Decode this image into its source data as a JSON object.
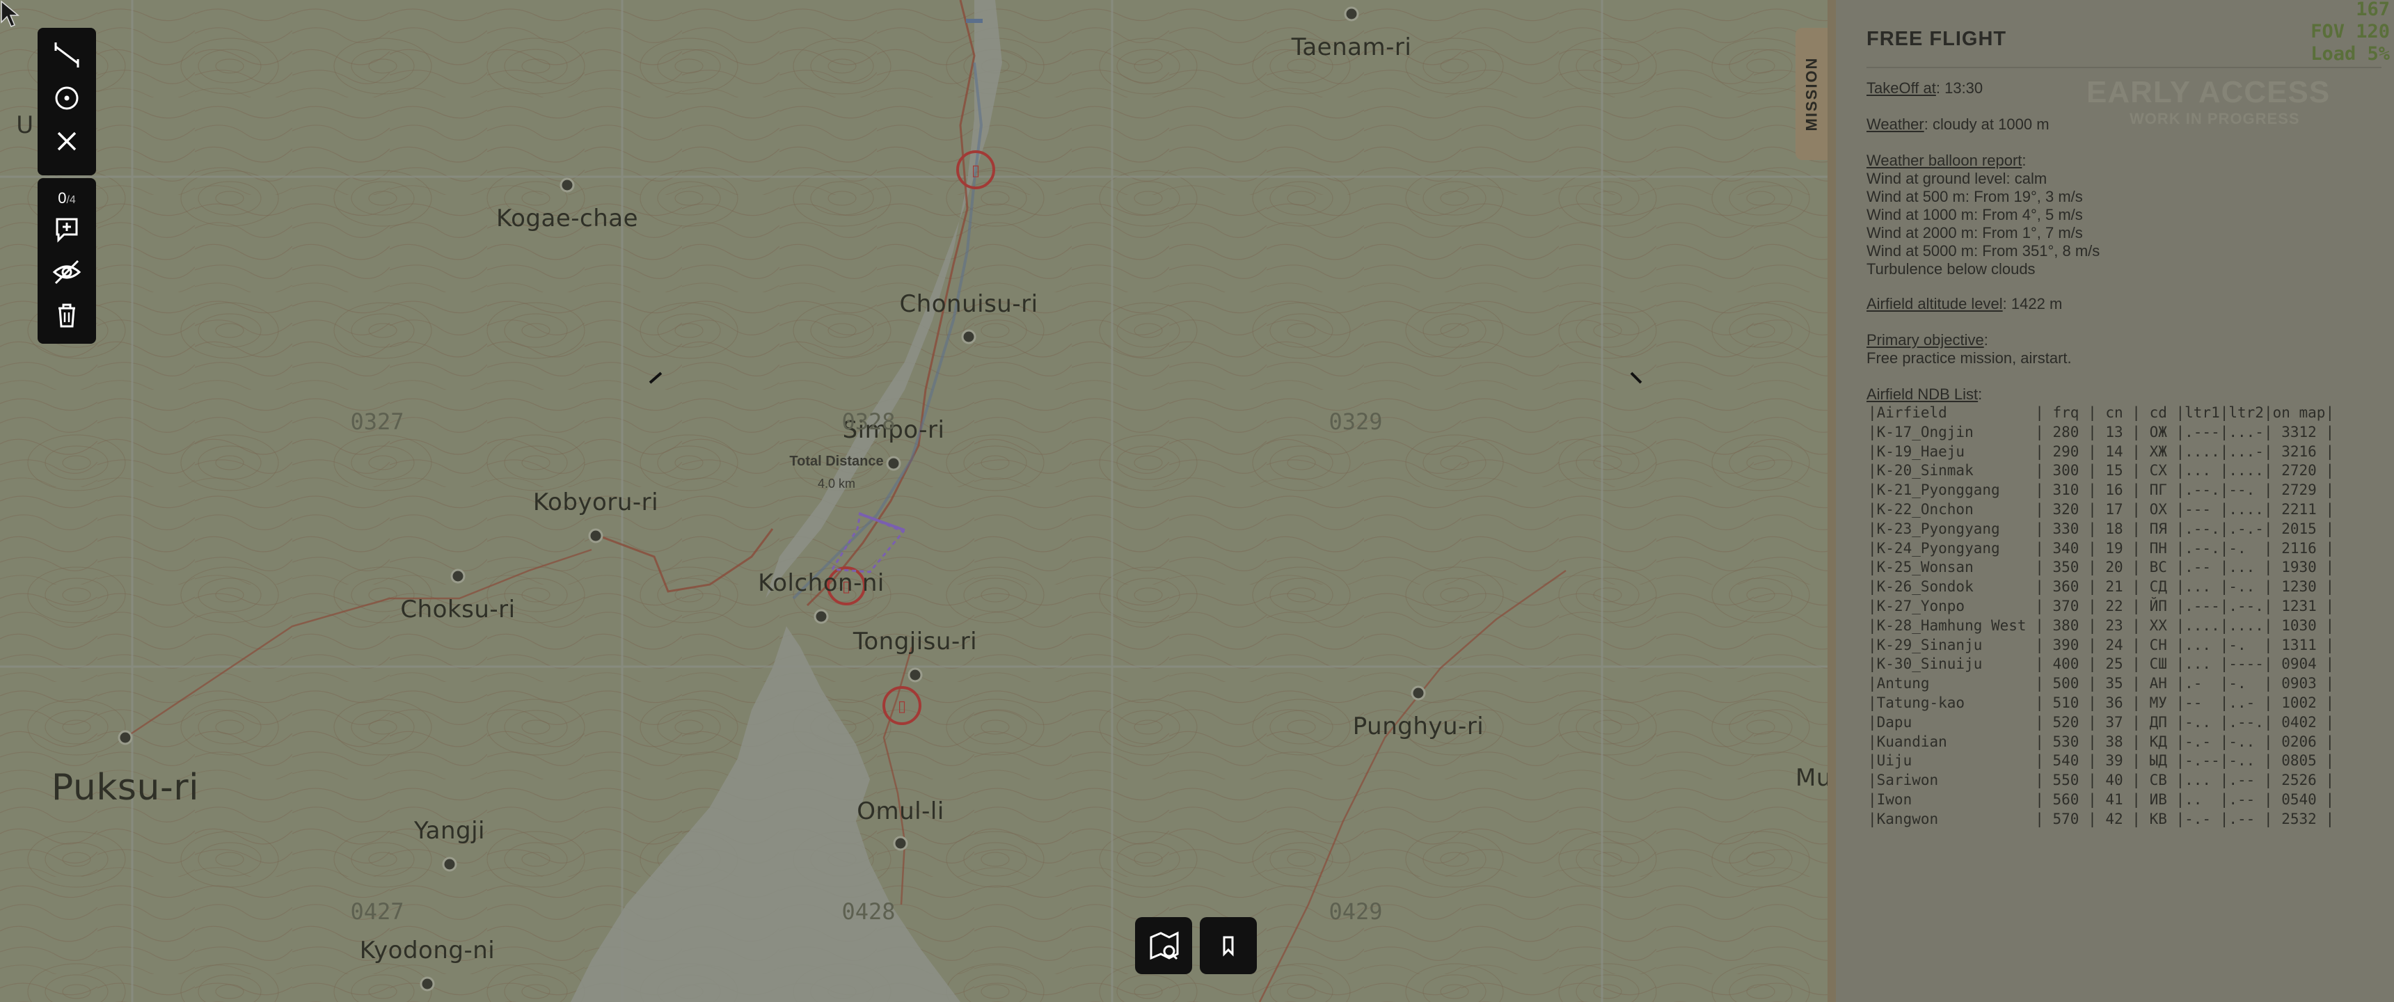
{
  "map": {
    "labels": [
      {
        "id": "taenam",
        "text": "Taenam-ri"
      },
      {
        "id": "kogae",
        "text": "Kogae-chae"
      },
      {
        "id": "chonuisu",
        "text": "Chonuisu-ri"
      },
      {
        "id": "simpo",
        "text": "Simpo-ri"
      },
      {
        "id": "kobyoru",
        "text": "Kobyoru-ri"
      },
      {
        "id": "kolcho",
        "text": "Kolchon-ni"
      },
      {
        "id": "choksu",
        "text": "Choksu-ri"
      },
      {
        "id": "tongjisu",
        "text": "Tongjisu-ri"
      },
      {
        "id": "punghyu",
        "text": "Punghyu-ri"
      },
      {
        "id": "puksu",
        "text": "Puksu-ri"
      },
      {
        "id": "omul",
        "text": "Omul-li"
      },
      {
        "id": "yangji",
        "text": "Yangji"
      },
      {
        "id": "kyodong",
        "text": "Kyodong-ni"
      },
      {
        "id": "u",
        "text": "U"
      },
      {
        "id": "mu",
        "text": "Mu"
      }
    ],
    "grid_labels": [
      "0327",
      "0328",
      "0329",
      "0427",
      "0428",
      "0429"
    ],
    "total_distance_label": "Total Distance",
    "total_distance_value": "4.0 km"
  },
  "toolbar": {
    "count_current": "0",
    "count_total": "/4",
    "icons": [
      "ruler-icon",
      "target-icon",
      "close-icon",
      "zoom-plus-icon",
      "hide-eye-icon",
      "trash-icon"
    ]
  },
  "mission_tab": {
    "label": "MISSION"
  },
  "panel": {
    "title": "FREE FLIGHT",
    "takeoff_label": "TakeOff at",
    "takeoff_value": ": 13:30",
    "weather_label": "Weather",
    "weather_value": ": cloudy at 1000 m",
    "balloon_label": "Weather balloon report",
    "balloon_colon": ":",
    "balloon_lines": [
      "Wind at ground level: calm",
      "Wind at 500 m: From 19°, 3 m/s",
      "Wind at 1000 m: From 4°, 5 m/s",
      "Wind at 2000 m: From 1°, 7 m/s",
      "Wind at 5000 m: From 351°, 8 m/s",
      "Turbulence below clouds"
    ],
    "altitude_label": "Airfield altitude level",
    "altitude_value": ": 1422 m",
    "objective_label": "Primary objective",
    "objective_colon": ":",
    "objective_text": "Free practice mission, airstart.",
    "ndb_label": "Airfield NDB List",
    "ndb_colon": ":",
    "ndb_rows": [
      "|Airfield          | frq | cn | cd |ltr1|ltr2|on map|",
      "|K-17_Ongjin       | 280 | 13 | ОЖ |.---|...-| 3312 |",
      "|K-19_Haeju        | 290 | 14 | ХЖ |....|...-| 3216 |",
      "|K-20_Sinmak       | 300 | 15 | СХ |... |....| 2720 |",
      "|K-21_Pyonggang    | 310 | 16 | ПГ |.--.|--. | 2729 |",
      "|K-22_Onchon       | 320 | 17 | ОХ |--- |....| 2211 |",
      "|K-23_Pyongyang    | 330 | 18 | ПЯ |.--.|.-.-| 2015 |",
      "|K-24_Pyongyang    | 340 | 19 | ПН |.--.|-.  | 2116 |",
      "|K-25_Wonsan       | 350 | 20 | ВС |.-- |... | 1930 |",
      "|K-26_Sondok       | 360 | 21 | СД |... |-.. | 1230 |",
      "|K-27_Yonpo        | 370 | 22 | ЙП |.---|.--.| 1231 |",
      "|K-28_Hamhung West | 380 | 23 | ХХ |....|....| 1030 |",
      "|K-29_Sinanju      | 390 | 24 | СН |... |-.  | 1311 |",
      "|K-30_Sinuiju      | 400 | 25 | СШ |... |----| 0904 |",
      "|Antung            | 500 | 35 | АН |.-  |-.  | 0903 |",
      "|Tatung-kao        | 510 | 36 | МУ |--  |..- | 1002 |",
      "|Dapu              | 520 | 37 | ДП |-.. |.--.| 0402 |",
      "|Kuandian          | 530 | 38 | КД |-.- |-.. | 0206 |",
      "|Uiju              | 540 | 39 | ЫД |-.--|-.. | 0805 |",
      "|Sariwon           | 550 | 40 | СВ |... |.-- | 2526 |",
      "|Iwon              | 560 | 41 | ИВ |..  |.-- | 0540 |",
      "|Kangwon           | 570 | 42 | КВ |-.- |.-- | 2532 |"
    ]
  },
  "watermark": {
    "line1": "EARLY ACCESS",
    "line2": "WORK IN PROGRESS"
  },
  "hud": {
    "line1": "167",
    "line2": "FOV 120",
    "line3": "Load 5%"
  },
  "bottom": {
    "icons": [
      "map-search-icon",
      "bookmark-icon"
    ]
  }
}
